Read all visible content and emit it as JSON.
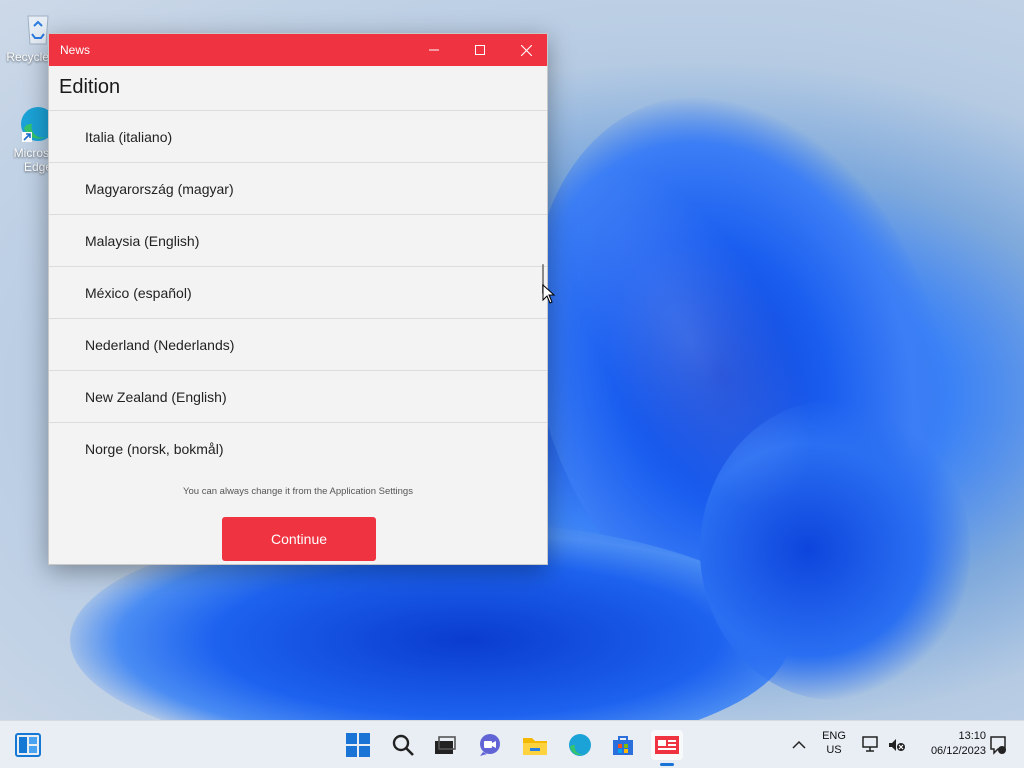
{
  "desktop": {
    "icons": [
      {
        "label": "Recycle Bin"
      },
      {
        "label": "Microsoft Edge"
      }
    ]
  },
  "window": {
    "title": "News",
    "heading": "Edition",
    "editions": [
      "Italia (italiano)",
      "Magyarország (magyar)",
      "Malaysia (English)",
      "México (español)",
      "Nederland (Nederlands)",
      "New Zealand (English)",
      "Norge (norsk, bokmål)"
    ],
    "hint": "You can always change it from the Application Settings",
    "continue_label": "Continue",
    "accent": "#ef3340"
  },
  "taskbar": {
    "language": "ENG",
    "region": "US",
    "time": "13:10",
    "date": "06/12/2023"
  }
}
